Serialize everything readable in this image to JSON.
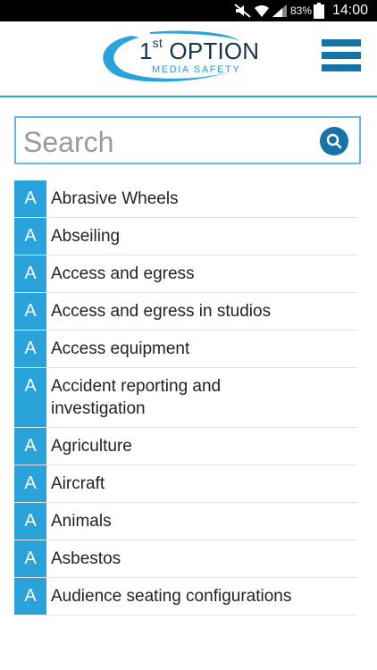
{
  "statusbar": {
    "battery_percent": "83%",
    "clock": "14:00"
  },
  "header": {
    "logo_main": "1",
    "logo_sup": "st",
    "logo_word": " OPTION",
    "logo_tagline": "MEDIA SAFETY",
    "menu_icon": "hamburger-menu-icon"
  },
  "search": {
    "placeholder": "Search",
    "icon": "search-icon"
  },
  "colors": {
    "accent": "#2aa3db",
    "brand_dark": "#1673a8",
    "text": "#222222"
  },
  "list": {
    "items": [
      {
        "letter": "A",
        "label": "Abrasive Wheels"
      },
      {
        "letter": "A",
        "label": "Abseiling"
      },
      {
        "letter": "A",
        "label": "Access and egress"
      },
      {
        "letter": "A",
        "label": "Access and egress in studios"
      },
      {
        "letter": "A",
        "label": "Access equipment"
      },
      {
        "letter": "A",
        "label": "Accident reporting and investigation"
      },
      {
        "letter": "A",
        "label": "Agriculture"
      },
      {
        "letter": "A",
        "label": "Aircraft"
      },
      {
        "letter": "A",
        "label": "Animals"
      },
      {
        "letter": "A",
        "label": "Asbestos"
      },
      {
        "letter": "A",
        "label": "Audience seating configurations"
      }
    ]
  }
}
